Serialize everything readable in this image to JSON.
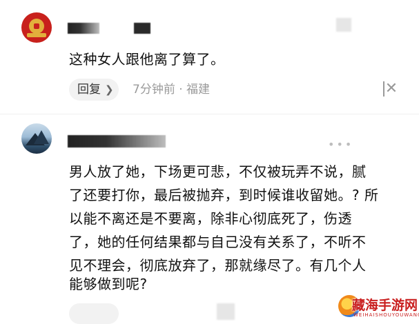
{
  "comments": [
    {
      "text": "这种女人跟他离了算了。",
      "reply_label": "回复",
      "meta": "7分钟前 · 福建"
    },
    {
      "lines": [
        "男人放了她，下场更可悲，不仅被玩弄不说，腻",
        "了还要打你，最后被抛弃，到时候谁收留她。? 所",
        "以能不离还是不要离，除非心彻底死了，伤透",
        "了，她的任何结果都与自己没有关系了，不听不",
        "见不理会，彻底放弃了，那就缘尽了。有几个人",
        "能够做到呢?"
      ]
    }
  ],
  "watermark": {
    "brand": "藏海手游网",
    "sub": "WEIHAISHOUYOUWANG"
  },
  "icons": {
    "reply_chevron": "chevron-right-icon",
    "close": "close-x-icon",
    "more": "more-dots-icon"
  },
  "colors": {
    "meta_gray": "#9a9a9a",
    "reply_bg": "#f2f2f2",
    "avatar1_red": "#c8211c",
    "watermark_red": "#c91f1f"
  }
}
